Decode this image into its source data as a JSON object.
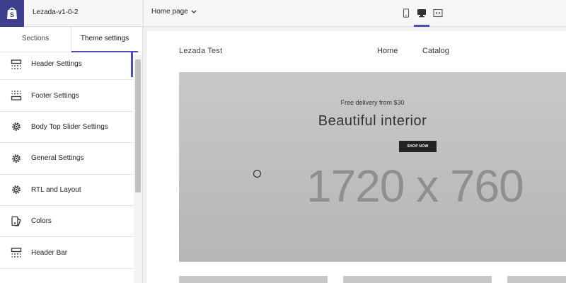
{
  "app": {
    "theme_name": "Lezada-v1-0-2",
    "page_select": "Home page"
  },
  "devices": [
    "mobile-icon",
    "desktop-icon",
    "fullscreen-icon"
  ],
  "sidebar": {
    "tabs": [
      {
        "label": "Sections"
      },
      {
        "label": "Theme settings",
        "active": true
      }
    ],
    "items": [
      {
        "label": "Header Settings",
        "icon": "header-layout-icon",
        "active": true
      },
      {
        "label": "Footer Settings",
        "icon": "footer-layout-icon"
      },
      {
        "label": "Body Top Slider Settings",
        "icon": "gear-icon"
      },
      {
        "label": "General Settings",
        "icon": "gear-icon"
      },
      {
        "label": "RTL and Layout",
        "icon": "gear-icon"
      },
      {
        "label": "Colors",
        "icon": "paint-bucket-icon"
      },
      {
        "label": "Header Bar",
        "icon": "header-bar-icon"
      }
    ]
  },
  "preview": {
    "store_name": "Lezada Test",
    "nav": [
      "Home",
      "Catalog"
    ],
    "hero": {
      "subtitle": "Free delivery from $30",
      "title": "Beautiful interior",
      "button": "SHOP NOW",
      "dimensions": "1720 x 760"
    }
  },
  "colors": {
    "accent": "#4a4fb3",
    "logo_bg": "#3d3f8f",
    "hero_bg": "#c4c4c4"
  }
}
